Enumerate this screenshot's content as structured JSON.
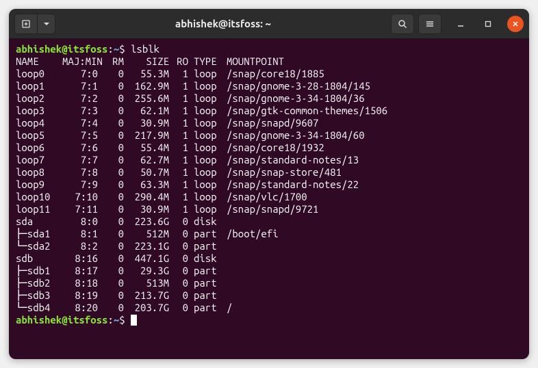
{
  "window": {
    "title": "abhishek@itsfoss: ~"
  },
  "prompt": {
    "user_host": "abhishek@itsfoss",
    "colon": ":",
    "path": "~",
    "symbol": "$"
  },
  "command": "lsblk",
  "columns": {
    "name": "NAME",
    "majmin": "MAJ:MIN",
    "rm": "RM",
    "size": "SIZE",
    "ro": "RO",
    "type": "TYPE",
    "mountpoint": "MOUNTPOINT"
  },
  "rows": [
    {
      "name": "loop0",
      "majmin": "7:0",
      "rm": "0",
      "size": "55.3M",
      "ro": "1",
      "type": "loop",
      "mountpoint": "/snap/core18/1885"
    },
    {
      "name": "loop1",
      "majmin": "7:1",
      "rm": "0",
      "size": "162.9M",
      "ro": "1",
      "type": "loop",
      "mountpoint": "/snap/gnome-3-28-1804/145"
    },
    {
      "name": "loop2",
      "majmin": "7:2",
      "rm": "0",
      "size": "255.6M",
      "ro": "1",
      "type": "loop",
      "mountpoint": "/snap/gnome-3-34-1804/36"
    },
    {
      "name": "loop3",
      "majmin": "7:3",
      "rm": "0",
      "size": "62.1M",
      "ro": "1",
      "type": "loop",
      "mountpoint": "/snap/gtk-common-themes/1506"
    },
    {
      "name": "loop4",
      "majmin": "7:4",
      "rm": "0",
      "size": "30.9M",
      "ro": "1",
      "type": "loop",
      "mountpoint": "/snap/snapd/9607"
    },
    {
      "name": "loop5",
      "majmin": "7:5",
      "rm": "0",
      "size": "217.9M",
      "ro": "1",
      "type": "loop",
      "mountpoint": "/snap/gnome-3-34-1804/60"
    },
    {
      "name": "loop6",
      "majmin": "7:6",
      "rm": "0",
      "size": "55.4M",
      "ro": "1",
      "type": "loop",
      "mountpoint": "/snap/core18/1932"
    },
    {
      "name": "loop7",
      "majmin": "7:7",
      "rm": "0",
      "size": "62.7M",
      "ro": "1",
      "type": "loop",
      "mountpoint": "/snap/standard-notes/13"
    },
    {
      "name": "loop8",
      "majmin": "7:8",
      "rm": "0",
      "size": "50.7M",
      "ro": "1",
      "type": "loop",
      "mountpoint": "/snap/snap-store/481"
    },
    {
      "name": "loop9",
      "majmin": "7:9",
      "rm": "0",
      "size": "63.3M",
      "ro": "1",
      "type": "loop",
      "mountpoint": "/snap/standard-notes/22"
    },
    {
      "name": "loop10",
      "majmin": "7:10",
      "rm": "0",
      "size": "290.4M",
      "ro": "1",
      "type": "loop",
      "mountpoint": "/snap/vlc/1700"
    },
    {
      "name": "loop11",
      "majmin": "7:11",
      "rm": "0",
      "size": "30.9M",
      "ro": "1",
      "type": "loop",
      "mountpoint": "/snap/snapd/9721"
    },
    {
      "name": "sda",
      "majmin": "8:0",
      "rm": "0",
      "size": "223.6G",
      "ro": "0",
      "type": "disk",
      "mountpoint": ""
    },
    {
      "name": "├─sda1",
      "majmin": "8:1",
      "rm": "0",
      "size": "512M",
      "ro": "0",
      "type": "part",
      "mountpoint": "/boot/efi"
    },
    {
      "name": "└─sda2",
      "majmin": "8:2",
      "rm": "0",
      "size": "223.1G",
      "ro": "0",
      "type": "part",
      "mountpoint": ""
    },
    {
      "name": "sdb",
      "majmin": "8:16",
      "rm": "0",
      "size": "447.1G",
      "ro": "0",
      "type": "disk",
      "mountpoint": ""
    },
    {
      "name": "├─sdb1",
      "majmin": "8:17",
      "rm": "0",
      "size": "29.3G",
      "ro": "0",
      "type": "part",
      "mountpoint": ""
    },
    {
      "name": "├─sdb2",
      "majmin": "8:18",
      "rm": "0",
      "size": "513M",
      "ro": "0",
      "type": "part",
      "mountpoint": ""
    },
    {
      "name": "├─sdb3",
      "majmin": "8:19",
      "rm": "0",
      "size": "213.7G",
      "ro": "0",
      "type": "part",
      "mountpoint": ""
    },
    {
      "name": "└─sdb4",
      "majmin": "8:20",
      "rm": "0",
      "size": "203.7G",
      "ro": "0",
      "type": "part",
      "mountpoint": "/"
    }
  ]
}
